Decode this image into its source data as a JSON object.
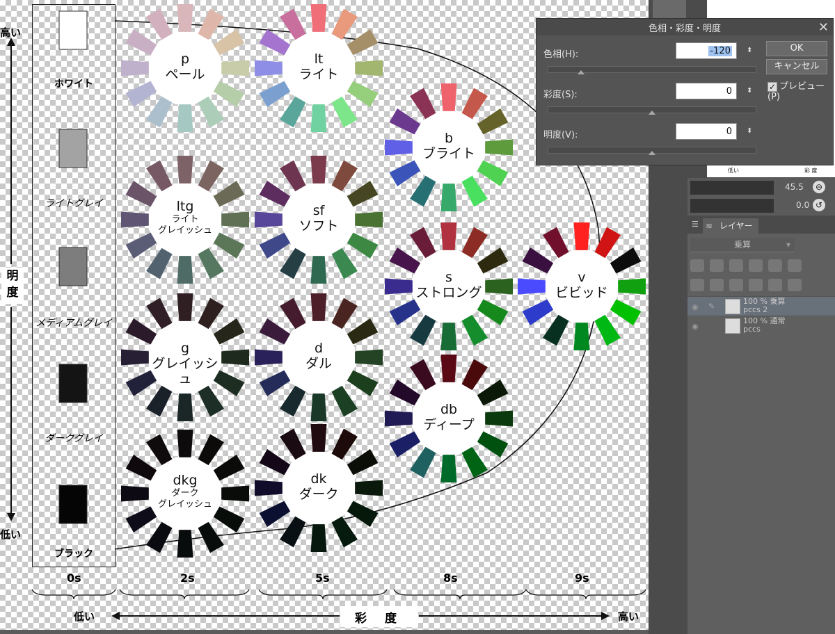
{
  "canvas": {
    "axis": {
      "vertical_top": "高い",
      "vertical_bottom": "低い",
      "vertical_title": "明\n度",
      "horizontal_left": "低い",
      "horizontal_right": "高い",
      "horizontal_title": "彩 度"
    },
    "saturation_levels": [
      "0s",
      "2s",
      "5s",
      "8s",
      "9s"
    ],
    "achromatic": [
      {
        "name": "ホワイト",
        "color": "#ffffff"
      },
      {
        "name": "ライトグレイ",
        "color": "#a3a3a3"
      },
      {
        "name": "メディアムグレイ",
        "color": "#7d7d7d"
      },
      {
        "name": "ダークグレイ",
        "color": "#141414"
      },
      {
        "name": "ブラック",
        "color": "#050505"
      }
    ],
    "tones": [
      {
        "code": "p",
        "name": "ペール",
        "colors": [
          "#d8b6ba",
          "#dfb6aa",
          "#d8c3a7",
          "#c9cca8",
          "#b6cdaa",
          "#acceb8",
          "#a6c8c2",
          "#abbfcd",
          "#b3b4d2",
          "#bfb0cb",
          "#c9afc3",
          "#d3b0bd"
        ]
      },
      {
        "code": "lt",
        "name": "ライト",
        "colors": [
          "#ef6e78",
          "#e9997c",
          "#a58f69",
          "#a2b66f",
          "#95cf7b",
          "#7ee68a",
          "#6fd2a0",
          "#5aa69a",
          "#7ba0d0",
          "#8f8ee6",
          "#a474cf",
          "#c86f9e"
        ]
      },
      {
        "code": "b",
        "name": "ブライト",
        "colors": [
          "#ef646c",
          "#c4584b",
          "#65632a",
          "#5d9b3c",
          "#4fd151",
          "#49e060",
          "#37a96a",
          "#266f73",
          "#3b54b9",
          "#5f60e5",
          "#6b3a8f",
          "#8a3354"
        ]
      },
      {
        "code": "ltg",
        "name": "ライト\nグレイッシュ",
        "colors": [
          "#7d6368",
          "#7c6560",
          "#6a6a56",
          "#5f7054",
          "#5b7758",
          "#567861",
          "#4e6b66",
          "#52626f",
          "#5b5d77",
          "#605673",
          "#6b5468",
          "#775865"
        ]
      },
      {
        "code": "sf",
        "name": "ソフト",
        "colors": [
          "#7b3b4d",
          "#7f4a3e",
          "#464722",
          "#4a7233",
          "#3d8944",
          "#3b8950",
          "#2f6a50",
          "#253f45",
          "#3f4889",
          "#58469a",
          "#5e2d60",
          "#6e3550"
        ]
      },
      {
        "code": "s",
        "name": "ストロング",
        "colors": [
          "#b0313f",
          "#8d2c25",
          "#2d2a10",
          "#2c6220",
          "#16891d",
          "#168d2c",
          "#186c35",
          "#173a40",
          "#27338b",
          "#3a2c8e",
          "#47154b",
          "#6a1d39"
        ]
      },
      {
        "code": "v",
        "name": "ビビッド",
        "colors": [
          "#ff2020",
          "#d01414",
          "#0c0c0c",
          "#10a010",
          "#00c000",
          "#00b814",
          "#008820",
          "#083020",
          "#2e3ccc",
          "#4a4aff",
          "#3a1040",
          "#70102c"
        ]
      },
      {
        "code": "g",
        "name": "グレイッシュ",
        "colors": [
          "#2f1f22",
          "#2f2020",
          "#26261a",
          "#1f2a1e",
          "#1e2d22",
          "#1d2e26",
          "#1a2726",
          "#1b2129",
          "#22213a",
          "#271f34",
          "#2b1b2a",
          "#301f26"
        ]
      },
      {
        "code": "d",
        "name": "ダル",
        "colors": [
          "#4d1f29",
          "#4a2420",
          "#2a2a14",
          "#244224",
          "#1c3f1d",
          "#1b4024",
          "#193828",
          "#182a2e",
          "#252c5a",
          "#2b215a",
          "#3a1b3c",
          "#441c2d"
        ]
      },
      {
        "code": "db",
        "name": "ディープ",
        "colors": [
          "#5a0a14",
          "#4a0a0c",
          "#0c1808",
          "#0a3a0e",
          "#005010",
          "#006414",
          "#006a2a",
          "#1f6060",
          "#1a1f66",
          "#201a55",
          "#240a2a",
          "#3a0a1e"
        ]
      },
      {
        "code": "dkg",
        "name": "ダーク\nグレイッシュ",
        "colors": [
          "#0d0b0c",
          "#0d0b0a",
          "#0b0b09",
          "#090c09",
          "#080d0a",
          "#080d0b",
          "#090c0c",
          "#0a0b10",
          "#0d0c18",
          "#0e0a14",
          "#0f090d",
          "#0f0a0c"
        ]
      },
      {
        "code": "dk",
        "name": "ダーク",
        "colors": [
          "#200c10",
          "#1d0b0a",
          "#0b0e06",
          "#0b180c",
          "#06180a",
          "#061a0e",
          "#07180f",
          "#091014",
          "#0c1030",
          "#100c2a",
          "#140818",
          "#1a0a12"
        ]
      }
    ]
  },
  "dialog": {
    "title": "色相・彩度・明度",
    "close": "✕",
    "hue_label": "色相(H):",
    "hue_value": "-120",
    "saturation_label": "彩度(S):",
    "saturation_value": "0",
    "value_label": "明度(V):",
    "value_value": "0",
    "ok_label": "OK",
    "cancel_label": "キャンセル",
    "preview_label": "プレビュー(P)",
    "spin_glyph": "⬍",
    "hue_fraction": 0.16,
    "saturation_fraction": 0.5,
    "value_fraction": 0.5
  },
  "brush": {
    "size_value": "45.5",
    "rotation_value": "0.0"
  },
  "layers": {
    "tab_label": "レイヤー",
    "blend_mode": "乗算",
    "items": [
      {
        "name": "100 % 乗算",
        "sub": "pccs 2",
        "active": true
      },
      {
        "name": "100 % 通常",
        "sub": "pccs",
        "active": false
      }
    ]
  },
  "thumbnail": {
    "label_low": "低い",
    "label_saido": "彩  度"
  }
}
